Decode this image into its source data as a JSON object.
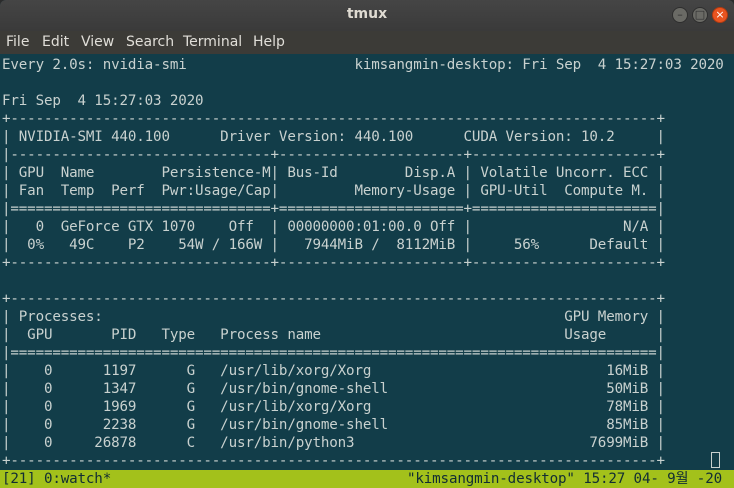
{
  "window": {
    "title": "tmux"
  },
  "menubar": {
    "items": [
      "File",
      "Edit",
      "View",
      "Search",
      "Terminal",
      "Help"
    ]
  },
  "terminal": {
    "lines": [
      "Every 2.0s: nvidia-smi                    kimsangmin-desktop: Fri Sep  4 15:27:03 2020",
      "",
      "Fri Sep  4 15:27:03 2020",
      "+-----------------------------------------------------------------------------+",
      "| NVIDIA-SMI 440.100      Driver Version: 440.100      CUDA Version: 10.2     |",
      "|-------------------------------+----------------------+----------------------+",
      "| GPU  Name        Persistence-M| Bus-Id        Disp.A | Volatile Uncorr. ECC |",
      "| Fan  Temp  Perf  Pwr:Usage/Cap|         Memory-Usage | GPU-Util  Compute M. |",
      "|===============================+======================+======================|",
      "|   0  GeForce GTX 1070    Off  | 00000000:01:00.0 Off |                  N/A |",
      "|  0%   49C    P2    54W / 166W |   7944MiB /  8112MiB |     56%      Default |",
      "+-------------------------------+----------------------+----------------------+",
      "",
      "+-----------------------------------------------------------------------------+",
      "| Processes:                                                       GPU Memory |",
      "|  GPU       PID   Type   Process name                             Usage      |",
      "|=============================================================================|",
      "|    0      1197      G   /usr/lib/xorg/Xorg                            16MiB |",
      "|    0      1347      G   /usr/bin/gnome-shell                          50MiB |",
      "|    0      1969      G   /usr/lib/xorg/Xorg                            78MiB |",
      "|    0      2238      G   /usr/bin/gnome-shell                          85MiB |",
      "|    0     26878      C   /usr/bin/python3                            7699MiB |",
      "+-----------------------------------------------------------------------------+"
    ]
  },
  "statusbar": {
    "left": "[21] 0:watch*",
    "right": "\"kimsangmin-desktop\" 15:27 04- 9월 -20"
  },
  "colors": {
    "terminal_bg": "#123d49",
    "terminal_fg": "#c8d1cf",
    "statusbar_bg": "#a3c11b",
    "close_button": "#e95420"
  }
}
